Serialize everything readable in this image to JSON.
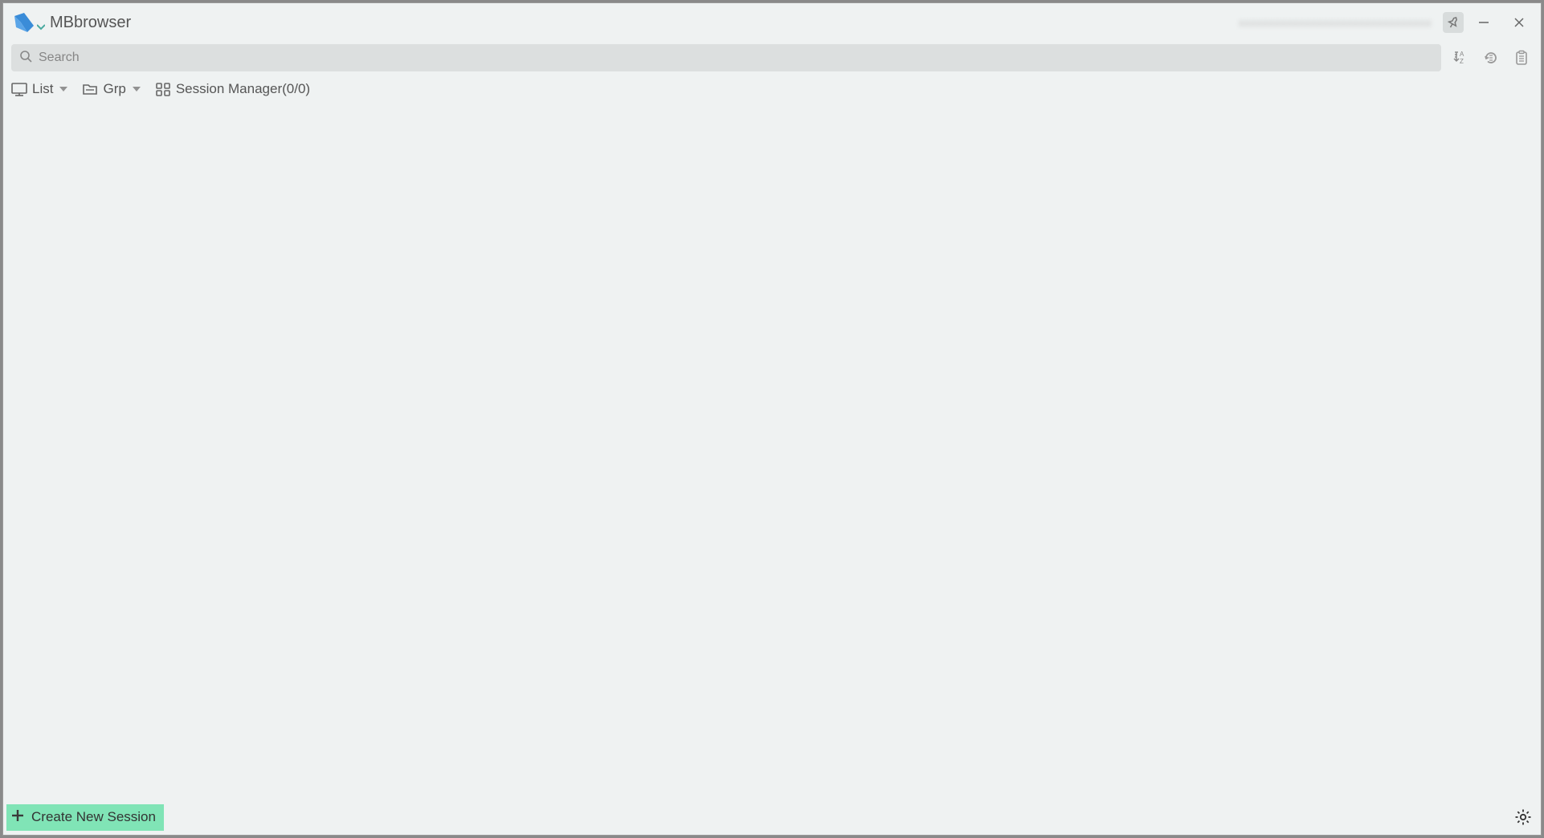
{
  "app": {
    "title": "MBbrowser"
  },
  "titlebar": {
    "blurred_account": "xxxxxxxxxxxxxxxxxxxxxxxxxxxxxxxx"
  },
  "search": {
    "placeholder": "Search"
  },
  "viewbar": {
    "list_label": "List",
    "grp_label": "Grp",
    "session_manager_label": "Session Manager(0/0)"
  },
  "bottom": {
    "create_session_label": "Create New Session"
  }
}
